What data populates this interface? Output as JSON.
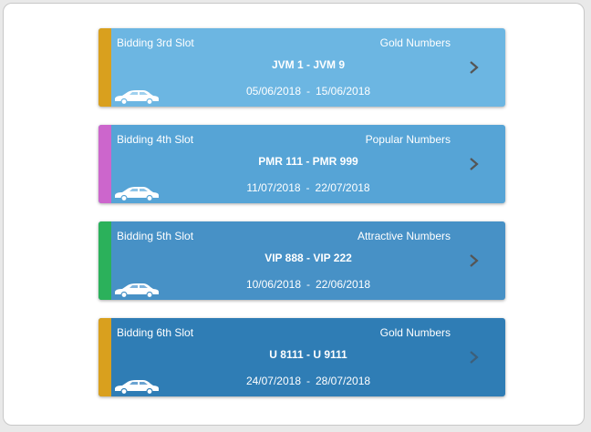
{
  "colors": {
    "gold_stripe": "#d9a01e",
    "popular_stripe": "#cc66cc",
    "attractive_stripe": "#2bb15b",
    "card_1": "#6cb6e2",
    "card_2": "#56a4d6",
    "card_3": "#4791c6",
    "card_4": "#2f7db5"
  },
  "slots": [
    {
      "title": "Bidding 3rd Slot",
      "category": "Gold Numbers",
      "range": "JVM 1 - JVM 9",
      "start_date": "05/06/2018",
      "date_separator": "-",
      "end_date": "15/06/2018",
      "icon": "car-icon",
      "action_icon": "chevron-right-icon"
    },
    {
      "title": "Bidding 4th Slot",
      "category": "Popular Numbers",
      "range": "PMR 111 - PMR 999",
      "start_date": "11/07/2018",
      "date_separator": "-",
      "end_date": "22/07/2018",
      "icon": "car-icon",
      "action_icon": "chevron-right-icon"
    },
    {
      "title": "Bidding 5th Slot",
      "category": "Attractive Numbers",
      "range": "VIP 888 - VIP 222",
      "start_date": "10/06/2018",
      "date_separator": "-",
      "end_date": "22/06/2018",
      "icon": "car-icon",
      "action_icon": "chevron-right-icon"
    },
    {
      "title": "Bidding 6th Slot",
      "category": "Gold Numbers",
      "range": "U 8111 - U 9111",
      "start_date": "24/07/2018",
      "date_separator": "-",
      "end_date": "28/07/2018",
      "icon": "car-icon",
      "action_icon": "chevron-right-icon"
    }
  ]
}
